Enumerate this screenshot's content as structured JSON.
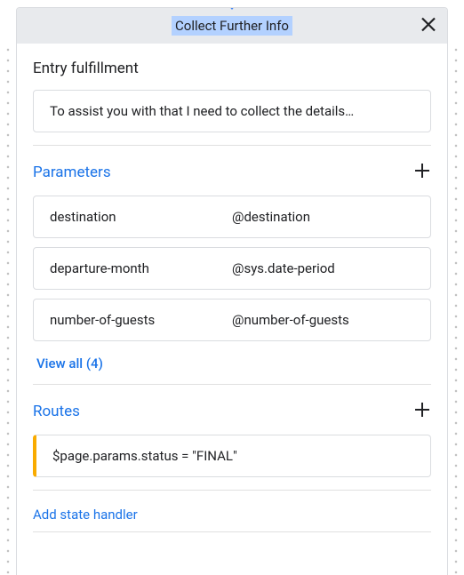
{
  "header": {
    "title": "Collect Further Info"
  },
  "entryFulfillment": {
    "title": "Entry fulfillment",
    "text": "To assist you with that I need to collect the details…"
  },
  "parameters": {
    "title": "Parameters",
    "items": [
      {
        "name": "destination",
        "entity": "@destination"
      },
      {
        "name": "departure-month",
        "entity": "@sys.date-period"
      },
      {
        "name": "number-of-guests",
        "entity": "@number-of-guests"
      }
    ],
    "viewAll": "View all (4)"
  },
  "routes": {
    "title": "Routes",
    "items": [
      {
        "condition": "$page.params.status = \"FINAL\""
      }
    ]
  },
  "stateHandler": {
    "label": "Add state handler"
  }
}
